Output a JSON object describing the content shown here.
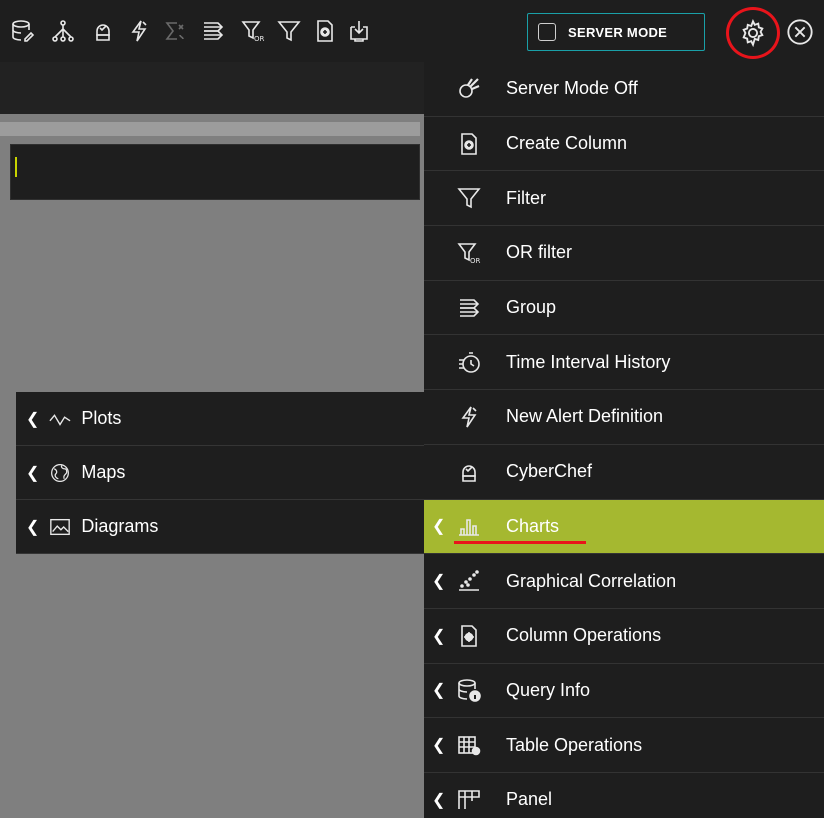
{
  "toolbar": {
    "icons": [
      "database-edit-icon",
      "hierarchy-icon",
      "cyberchef-icon",
      "alert-icon",
      "sigma-icon",
      "group-icon",
      "or-filter-icon",
      "filter-icon",
      "create-column-icon",
      "download-icon"
    ],
    "server_mode_label": "SERVER MODE",
    "settings_icon": "gear-icon",
    "close_icon": "close-circle-icon"
  },
  "menu": {
    "items": [
      {
        "label": "Server Mode Off",
        "icon": "server-mode-icon",
        "has_submenu": false
      },
      {
        "label": "Create Column",
        "icon": "create-column-icon",
        "has_submenu": false
      },
      {
        "label": "Filter",
        "icon": "filter-icon",
        "has_submenu": false
      },
      {
        "label": "OR filter",
        "icon": "or-filter-icon",
        "has_submenu": false
      },
      {
        "label": "Group",
        "icon": "group-icon",
        "has_submenu": false
      },
      {
        "label": "Time Interval History",
        "icon": "timer-icon",
        "has_submenu": false
      },
      {
        "label": "New Alert Definition",
        "icon": "alert-icon",
        "has_submenu": false
      },
      {
        "label": "CyberChef",
        "icon": "cyberchef-icon",
        "has_submenu": false
      },
      {
        "label": "Charts",
        "icon": "bar-chart-icon",
        "has_submenu": true,
        "active": true
      },
      {
        "label": "Graphical Correlation",
        "icon": "scatter-icon",
        "has_submenu": true
      },
      {
        "label": "Column Operations",
        "icon": "column-ops-icon",
        "has_submenu": true
      },
      {
        "label": "Query Info",
        "icon": "query-info-icon",
        "has_submenu": true
      },
      {
        "label": "Table Operations",
        "icon": "table-ops-icon",
        "has_submenu": true
      },
      {
        "label": "Panel",
        "icon": "panel-icon",
        "has_submenu": true
      }
    ]
  },
  "submenu": {
    "items": [
      {
        "label": "Plots",
        "icon": "plot-line-icon"
      },
      {
        "label": "Maps",
        "icon": "globe-icon"
      },
      {
        "label": "Diagrams",
        "icon": "diagram-icon"
      }
    ]
  },
  "colors": {
    "active_bg": "#a5b830",
    "highlight_red": "#e8141b",
    "toggle_border": "#1aa0a8",
    "panel_bg": "#1e1e1e",
    "canvas_bg": "#7f7f7f"
  }
}
